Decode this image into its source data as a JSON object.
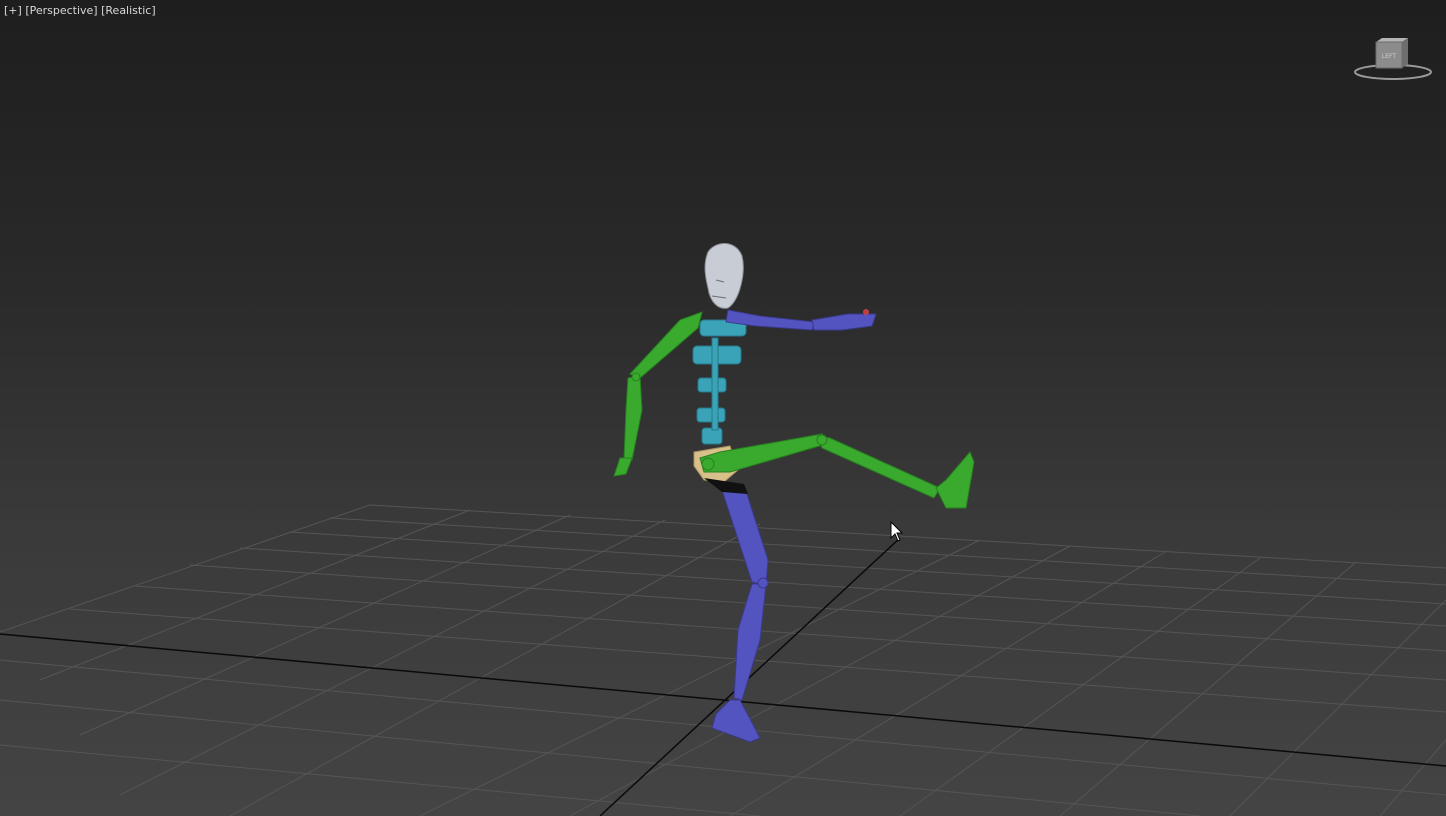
{
  "viewport": {
    "menu_label": "[+]",
    "view_label": "[Perspective]",
    "shading_label": "[Realistic]",
    "viewcube_face": "LEFT"
  },
  "colors": {
    "background_top": "#1e1e1e",
    "background_bottom": "#444444",
    "grid_line": "#555555",
    "axis_line": "#0a0a0a",
    "biped_green": "#3aaa2e",
    "biped_blue": "#5454c0",
    "biped_spine": "#3aa3b8",
    "biped_head": "#c8ccd4",
    "biped_pelvis": "#d8c08a"
  },
  "scene": {
    "object": "biped-skeleton",
    "grid": true
  }
}
